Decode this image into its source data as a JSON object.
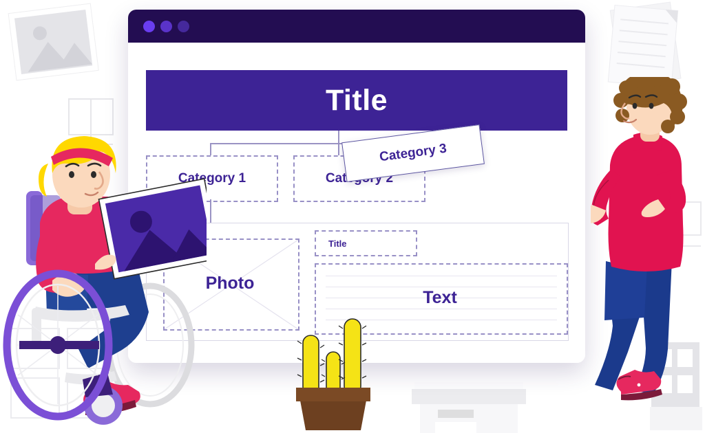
{
  "window": {
    "dots": [
      "window-dot-1",
      "window-dot-2",
      "window-dot-3"
    ],
    "titlebar_color": "#230d52"
  },
  "page": {
    "title_banner": {
      "label": "Title",
      "bg": "#3d2395",
      "text_color": "#ffffff"
    },
    "categories": [
      {
        "label": "Category 1",
        "style": "dashed-box"
      },
      {
        "label": "Category 2",
        "style": "dashed-box"
      },
      {
        "label": "Category 3",
        "style": "tilted-card"
      }
    ],
    "content": {
      "photo_placeholder": {
        "label": "Photo",
        "style": "dashed-box-with-x"
      },
      "section_title": {
        "label": "Title",
        "style": "dashed-box"
      },
      "text_block": {
        "label": "Text",
        "style": "dashed-box-ruled",
        "rule_count": 5
      }
    },
    "accent_color": "#3d2395",
    "dash_color": "#9890c6"
  },
  "illustration": {
    "person_left": {
      "name": "woman-in-wheelchair",
      "hair": "#ffd800",
      "headband": "#e6285f",
      "shirt": "#e6285f",
      "pants": "#1e3f8f",
      "shoes": "#e6285f",
      "wheelchair_rim": "#7b4fd6",
      "holding": "image-card"
    },
    "person_right": {
      "name": "man-standing",
      "hair": "#8a5a22",
      "sweater": "#e11350",
      "pants": "#1b3a8c",
      "shoes": "#e6285f",
      "holding": "category-3-card"
    },
    "props": [
      {
        "name": "image-placeholder-card-top-left",
        "color": "#e4e4e8"
      },
      {
        "name": "paper-stack-top-right",
        "color": "#f2f2f4"
      },
      {
        "name": "cactus-plant",
        "plant_color": "#f5e316",
        "pot_color": "#6d4020"
      },
      {
        "name": "storage-box-bottom",
        "color": "#e6e6e8"
      },
      {
        "name": "shelf-bottom-right",
        "color": "#e4e4e8"
      }
    ]
  }
}
